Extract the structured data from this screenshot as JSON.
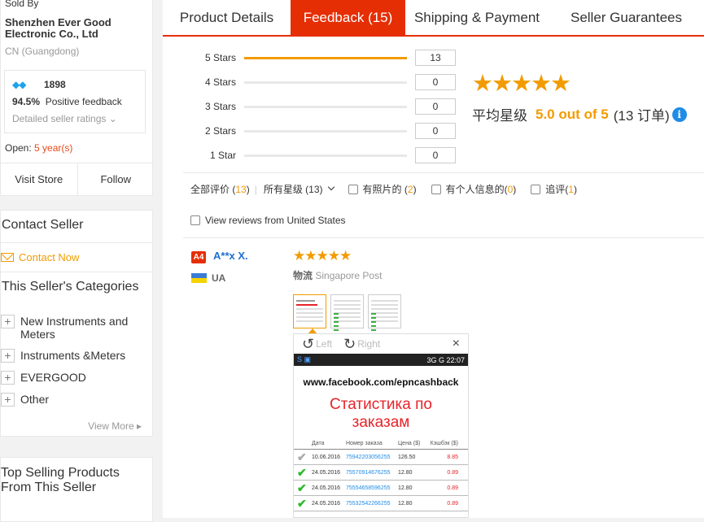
{
  "seller": {
    "sold_by_label": "Sold By",
    "shop_name": "Shenzhen Ever Good Electronic Co., Ltd",
    "location": "CN (Guangdong)",
    "score": "1898",
    "positive_pct": "94.5%",
    "positive_label": "Positive feedback",
    "detailed_ratings": "Detailed seller ratings",
    "open_label": "Open:",
    "open_years": "5 year(s)",
    "visit_store": "Visit Store",
    "follow": "Follow"
  },
  "contact": {
    "title": "Contact Seller",
    "contact_now": "Contact Now",
    "categories_title": "This Seller's Categories",
    "categories": [
      "New Instruments and Meters",
      "Instruments &Meters",
      "EVERGOOD",
      "Other"
    ],
    "view_more": "View More",
    "top_selling": "Top Selling Products From This Seller"
  },
  "tabs": [
    "Product Details",
    "Feedback (15)",
    "Shipping & Payment",
    "Seller Guarantees"
  ],
  "active_tab": 1,
  "ratings": {
    "rows": [
      {
        "label": "5 Stars",
        "count": "13",
        "fill": 1.0
      },
      {
        "label": "4 Stars",
        "count": "0",
        "fill": 0
      },
      {
        "label": "3 Stars",
        "count": "0",
        "fill": 0
      },
      {
        "label": "2 Stars",
        "count": "0",
        "fill": 0
      },
      {
        "label": "1 Star",
        "count": "0",
        "fill": 0
      }
    ],
    "stars": "★★★★★",
    "avg_label": "平均星级",
    "avg_score": "5.0 out of 5",
    "avg_orders": "(13 订单)",
    "info_glyph": "i"
  },
  "filters": {
    "all_label": "全部评价",
    "all_count": "13",
    "star_select": "所有星级 (13)",
    "photos_label": "有照片的",
    "photos_count": "2",
    "personal_label": "有个人信息的",
    "personal_count": "0",
    "followup_label": "追评",
    "followup_count": "1",
    "us_label": "View reviews from United States"
  },
  "review": {
    "badge": "A4",
    "name": "A**x X.",
    "country": "UA",
    "stars": "★★★★★",
    "logistics_label": "物流",
    "logistics_value": "Singapore Post",
    "viewer_left": "Left",
    "viewer_right": "Right",
    "close": "×",
    "phone_status": "3G  G  22:07",
    "screenshot": {
      "url": "www.facebook.com/epncashback",
      "heading1": "Статистика по",
      "heading2": "заказам",
      "headers": [
        "Дата",
        "Номер заказа",
        "Цена ($)",
        "Кэшбэк ($)"
      ],
      "rows": [
        [
          "10.06.2016",
          "75942203056255",
          "126.50",
          "8.85"
        ],
        [
          "24.05.2016",
          "75570914676255",
          "12.80",
          "0.89"
        ],
        [
          "24.05.2016",
          "75554658596255",
          "12.80",
          "0.89"
        ],
        [
          "24.05.2016",
          "75532542266255",
          "12.80",
          "0.89"
        ]
      ]
    }
  }
}
